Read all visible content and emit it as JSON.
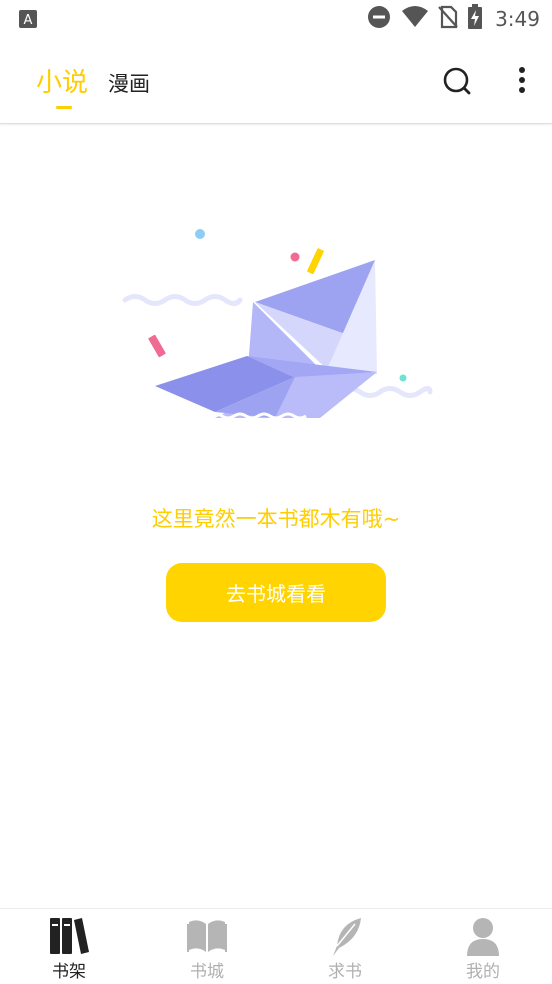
{
  "status_bar": {
    "time": "3:49",
    "icons": [
      "app-notification-icon",
      "do-not-disturb-icon",
      "wifi-icon",
      "no-sim-icon",
      "battery-charging-icon"
    ],
    "icon_color": "#555555"
  },
  "top_tabs": {
    "items": [
      {
        "label": "小说",
        "active": true
      },
      {
        "label": "漫画",
        "active": false
      }
    ],
    "active_color": "#ffce00",
    "icons": [
      "search-icon",
      "more-vertical-icon"
    ]
  },
  "empty_state": {
    "illustration": "paper-boat-illustration",
    "message": "这里竟然一本书都木有哦~",
    "button_label": "去书城看看",
    "accent_color": "#ffd400"
  },
  "bottom_nav": {
    "items": [
      {
        "label": "书架",
        "icon": "bookshelf-icon",
        "active": true
      },
      {
        "label": "书城",
        "icon": "open-book-icon",
        "active": false
      },
      {
        "label": "求书",
        "icon": "feather-icon",
        "active": false
      },
      {
        "label": "我的",
        "icon": "profile-icon",
        "active": false
      }
    ],
    "active_color": "#222222",
    "inactive_color": "#b0b0b0"
  }
}
